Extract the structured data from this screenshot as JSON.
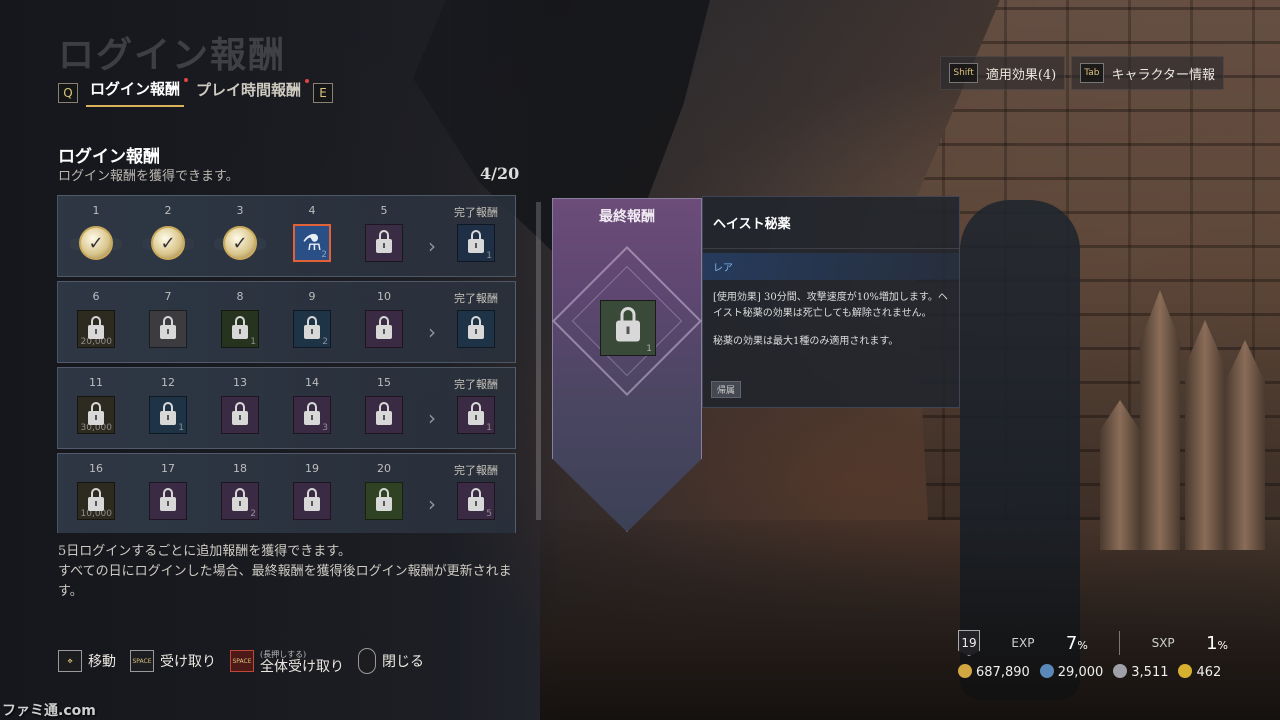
{
  "page": {
    "big_title": "ログイン報酬"
  },
  "tabs": {
    "left_key": "Q",
    "right_key": "E",
    "items": [
      {
        "label": "ログイン報酬",
        "active": true
      },
      {
        "label": "プレイ時間報酬",
        "active": false
      }
    ]
  },
  "top_right": {
    "effects_key": "Shift",
    "effects_label": "適用効果(4)",
    "char_key": "Tab",
    "char_label": "キャラクター情報"
  },
  "section": {
    "title": "ログイン報酬",
    "subtitle": "ログイン報酬を獲得できます。",
    "progress": "4/20",
    "complete_label": "完了報酬"
  },
  "grid": [
    {
      "days": [
        "1",
        "2",
        "3",
        "4",
        "5"
      ],
      "qty": [
        "100",
        "",
        "",
        "2",
        ""
      ],
      "complete_qty": "1"
    },
    {
      "days": [
        "6",
        "7",
        "8",
        "9",
        "10"
      ],
      "qty": [
        "20,000",
        "",
        "1",
        "2",
        ""
      ],
      "complete_qty": ""
    },
    {
      "days": [
        "11",
        "12",
        "13",
        "14",
        "15"
      ],
      "qty": [
        "30,000",
        "1",
        "",
        "3",
        ""
      ],
      "complete_qty": "1"
    },
    {
      "days": [
        "16",
        "17",
        "18",
        "19",
        "20"
      ],
      "qty": [
        "10,000",
        "",
        "2",
        "",
        ""
      ],
      "complete_qty": "5"
    }
  ],
  "notes": {
    "line1": "5日ログインするごとに追加報酬を獲得できます。",
    "line2": "すべての日にログインした場合、最終報酬を獲得後ログイン報酬が更新されます。"
  },
  "footer": {
    "move": "移動",
    "receive_key": "SPACE",
    "receive": "受け取り",
    "hold_hint": "(長押しする)",
    "receive_all": "全体受け取り",
    "close": "閉じる"
  },
  "final": {
    "title": "最終報酬",
    "qty": "1"
  },
  "tooltip": {
    "name": "ヘイスト秘薬",
    "rarity": "レア",
    "desc1": "[使用効果] 30分間、攻撃速度が10%増加します。ヘイスト秘薬の効果は死亡しても解除されません。",
    "desc2": "秘薬の効果は最大1種のみ適用されます。",
    "tag": "帰属"
  },
  "status": {
    "level": "19",
    "exp_label": "EXP",
    "exp_value": "7",
    "sxp_label": "SXP",
    "sxp_value": "1",
    "percent": "%",
    "currencies": [
      "687,890",
      "29,000",
      "3,511",
      "462"
    ]
  },
  "watermark": "ファミ通.com",
  "colors": {
    "accent": "#d9b25a",
    "selected": "#e06236",
    "rarity": "#7fb3ea"
  }
}
